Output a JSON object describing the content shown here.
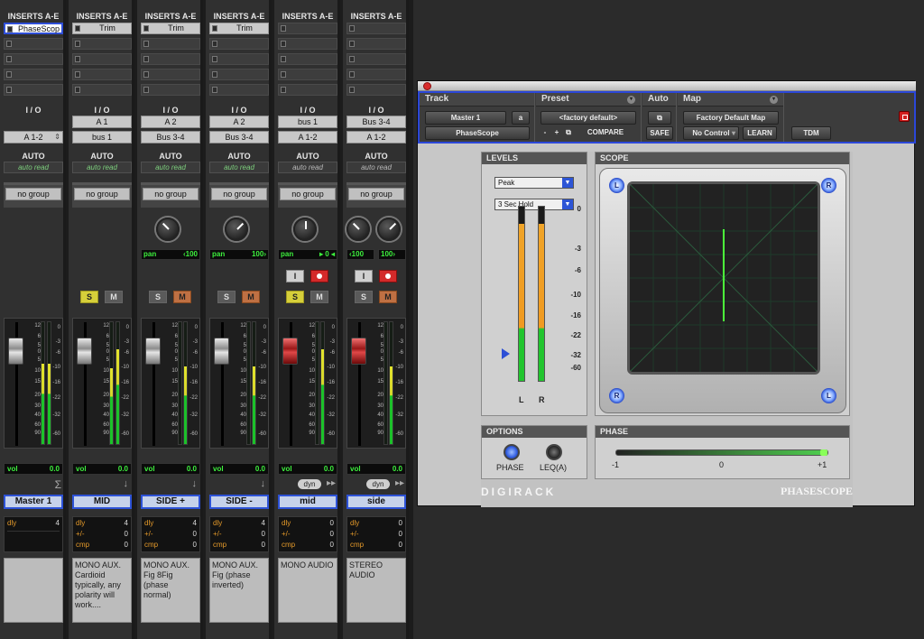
{
  "mixer": {
    "strips": [
      {
        "header": "INSERTS A-E",
        "inserts": [
          "PhaseScop",
          "",
          "",
          "",
          ""
        ],
        "io_label": "I / O",
        "input": "",
        "output": "A 1-2",
        "auto_label": "AUTO",
        "auto_mode": "auto read",
        "group": "no group",
        "pan": null,
        "solo_on": false,
        "mute_on": false,
        "has_solo": false,
        "has_mute": false,
        "has_input": false,
        "has_rec": false,
        "fader_red": false,
        "vol_label": "vol",
        "vol_value": "0.0",
        "extra": "sigma",
        "name": "Master 1",
        "delay": {
          "dly_label": "dly",
          "dly_value": "4"
        },
        "comment": "",
        "meter_levels": [
          0.66,
          0.66
        ]
      },
      {
        "header": "INSERTS A-E",
        "inserts": [
          "Trim",
          "",
          "",
          "",
          ""
        ],
        "io_label": "I / O",
        "input": "A 1",
        "output": "bus 1",
        "auto_label": "AUTO",
        "auto_mode": "auto read",
        "group": "no group",
        "pan": null,
        "solo_on": true,
        "mute_on": false,
        "has_solo": true,
        "has_mute": true,
        "has_input": false,
        "has_rec": false,
        "fader_red": false,
        "vol_label": "vol",
        "vol_value": "0.0",
        "extra": "arrow",
        "name": "MID",
        "delay": {
          "dly_label": "dly",
          "dly_value": "4",
          "pm_label": "+/-",
          "pm_value": "0",
          "cmp_label": "cmp",
          "cmp_value": "0"
        },
        "comment": "MONO AUX. Cardioid typically, any polarity will work....",
        "meter_levels": [
          0.62,
          0.78
        ]
      },
      {
        "header": "INSERTS A-E",
        "inserts": [
          "Trim",
          "",
          "",
          "",
          ""
        ],
        "io_label": "I / O",
        "input": "A 2",
        "output": "Bus 3-4",
        "auto_label": "AUTO",
        "auto_mode": "auto read",
        "group": "no group",
        "pan": {
          "label": "pan",
          "value": "‹100"
        },
        "knob_dir": "l",
        "solo_on": false,
        "mute_on": true,
        "has_solo": true,
        "has_mute": true,
        "has_input": false,
        "has_rec": false,
        "fader_red": false,
        "vol_label": "vol",
        "vol_value": "0.0",
        "extra": "arrow",
        "name": "SIDE +",
        "delay": {
          "dly_label": "dly",
          "dly_value": "4",
          "pm_label": "+/-",
          "pm_value": "0",
          "cmp_label": "cmp",
          "cmp_value": "0"
        },
        "comment": "MONO AUX. Fig 8Fig (phase normal)",
        "meter_levels": [
          0.0,
          0.64
        ]
      },
      {
        "header": "INSERTS A-E",
        "inserts": [
          "Trim",
          "",
          "",
          "",
          ""
        ],
        "io_label": "I / O",
        "input": "A 2",
        "output": "Bus 3-4",
        "auto_label": "AUTO",
        "auto_mode": "auto read",
        "group": "no group",
        "pan": {
          "label": "pan",
          "value": "100›"
        },
        "knob_dir": "r",
        "solo_on": false,
        "mute_on": true,
        "has_solo": true,
        "has_mute": true,
        "has_input": false,
        "has_rec": false,
        "fader_red": false,
        "vol_label": "vol",
        "vol_value": "0.0",
        "extra": "arrow",
        "name": "SIDE -",
        "delay": {
          "dly_label": "dly",
          "dly_value": "4",
          "pm_label": "+/-",
          "pm_value": "0",
          "cmp_label": "cmp",
          "cmp_value": "0"
        },
        "comment": "MONO AUX. Fig (phase inverted)",
        "meter_levels": [
          0.0,
          0.64
        ]
      },
      {
        "header": "INSERTS A-E",
        "inserts": [
          "",
          "",
          "",
          "",
          ""
        ],
        "io_label": "I / O",
        "input": "bus 1",
        "output": "A 1-2",
        "auto_label": "AUTO",
        "auto_mode": "auto read",
        "group": "no group",
        "pan": {
          "label": "pan",
          "value": "▸ 0 ◂"
        },
        "knob_dir": "c",
        "solo_on": true,
        "mute_on": false,
        "has_solo": true,
        "has_mute": true,
        "has_input": true,
        "has_rec": true,
        "fader_red": true,
        "vol_label": "vol",
        "vol_value": "0.0",
        "extra": "dyn",
        "dyn_label": "dyn",
        "name": "mid",
        "delay": {
          "dly_label": "dly",
          "dly_value": "0",
          "pm_label": "+/-",
          "pm_value": "0",
          "cmp_label": "cmp",
          "cmp_value": "0"
        },
        "comment": "MONO AUDIO",
        "meter_levels": [
          0.0,
          0.78
        ]
      },
      {
        "header": "INSERTS A-E",
        "inserts": [
          "",
          "",
          "",
          "",
          ""
        ],
        "io_label": "I / O",
        "input": "Bus 3-4",
        "output": "A 1-2",
        "auto_label": "AUTO",
        "auto_mode": "auto read",
        "group": "no group",
        "pan": {
          "label": "‹100",
          "value": "100›",
          "dual": true
        },
        "knob_dir": "l",
        "solo_on": false,
        "mute_on": true,
        "has_solo": true,
        "has_mute": true,
        "has_input": true,
        "has_rec": true,
        "fader_red": true,
        "vol_label": "vol",
        "vol_value": "0.0",
        "extra": "dyn",
        "dyn_label": "dyn",
        "name": "side",
        "delay": {
          "dly_label": "dly",
          "dly_value": "0",
          "pm_label": "+/-",
          "pm_value": "0",
          "cmp_label": "cmp",
          "cmp_value": "0"
        },
        "comment": "STEREO AUDIO",
        "meter_levels": [
          0.0,
          0.64
        ]
      }
    ],
    "fader_scale": [
      "12",
      "6",
      "5",
      "0",
      "5",
      "10",
      "15",
      "20",
      "30",
      "40",
      "60",
      "90"
    ],
    "meter_scale": [
      "0",
      "-3",
      "-6",
      "-10",
      "-16",
      "-22",
      "-32",
      "-60"
    ]
  },
  "plugin": {
    "header": {
      "track_label": "Track",
      "preset_label": "Preset",
      "auto_label": "Auto",
      "map_label": "Map",
      "track_name": "Master 1",
      "track_chan": "a",
      "plugin_name": "PhaseScope",
      "preset_name": "<factory default>",
      "minus": "-",
      "plus": "+",
      "compare": "COMPARE",
      "safe": "SAFE",
      "map_name": "Factory Default Map",
      "no_control": "No Control",
      "learn": "LEARN",
      "tdm": "TDM"
    },
    "levels": {
      "title": "LEVELS",
      "mode": "Peak",
      "hold": "3 Sec Hold",
      "scale": [
        "0",
        "-3",
        "-6",
        "-10",
        "-16",
        "-22",
        "-32",
        "-60"
      ],
      "left_label": "L",
      "right_label": "R",
      "left_level": 0.9,
      "right_level": 0.9
    },
    "scope": {
      "title": "SCOPE",
      "corner_l": "L",
      "corner_r": "R"
    },
    "options": {
      "title": "OPTIONS",
      "phase_label": "PHASE",
      "leq_label": "LEQ(A)"
    },
    "phase": {
      "title": "PHASE",
      "min": "-1",
      "mid": "0",
      "max": "+1",
      "value": 1.0
    },
    "brand_left": "DIGIRACK",
    "brand_right": "PHASESCOPE"
  }
}
